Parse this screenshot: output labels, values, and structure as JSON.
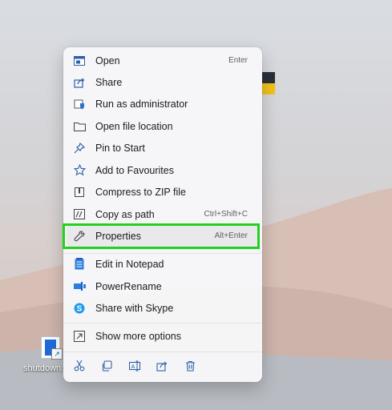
{
  "desktop": {
    "shortcut_label": "shutdown.exe"
  },
  "context_menu": {
    "items": [
      {
        "label": "Open",
        "shortcut": "Enter",
        "icon": "window-icon"
      },
      {
        "label": "Share",
        "shortcut": "",
        "icon": "share-icon"
      },
      {
        "label": "Run as administrator",
        "shortcut": "",
        "icon": "shield-icon"
      },
      {
        "label": "Open file location",
        "shortcut": "",
        "icon": "folder-icon"
      },
      {
        "label": "Pin to Start",
        "shortcut": "",
        "icon": "pin-icon"
      },
      {
        "label": "Add to Favourites",
        "shortcut": "",
        "icon": "star-icon"
      },
      {
        "label": "Compress to ZIP file",
        "shortcut": "",
        "icon": "zip-icon"
      },
      {
        "label": "Copy as path",
        "shortcut": "Ctrl+Shift+C",
        "icon": "path-icon"
      },
      {
        "label": "Properties",
        "shortcut": "Alt+Enter",
        "icon": "wrench-icon"
      }
    ],
    "extra_items": [
      {
        "label": "Edit in Notepad",
        "icon": "notepad-icon"
      },
      {
        "label": "PowerRename",
        "icon": "powerrename-icon"
      },
      {
        "label": "Share with Skype",
        "icon": "skype-icon"
      }
    ],
    "more_options": {
      "label": "Show more options",
      "icon": "more-options-icon"
    },
    "toolbar": [
      "cut-icon",
      "copy-icon",
      "rename-icon",
      "share-icon",
      "delete-icon"
    ],
    "highlighted_item": "Properties"
  },
  "colors": {
    "highlight_border": "#22d11e",
    "accent": "#1e6bd8"
  }
}
